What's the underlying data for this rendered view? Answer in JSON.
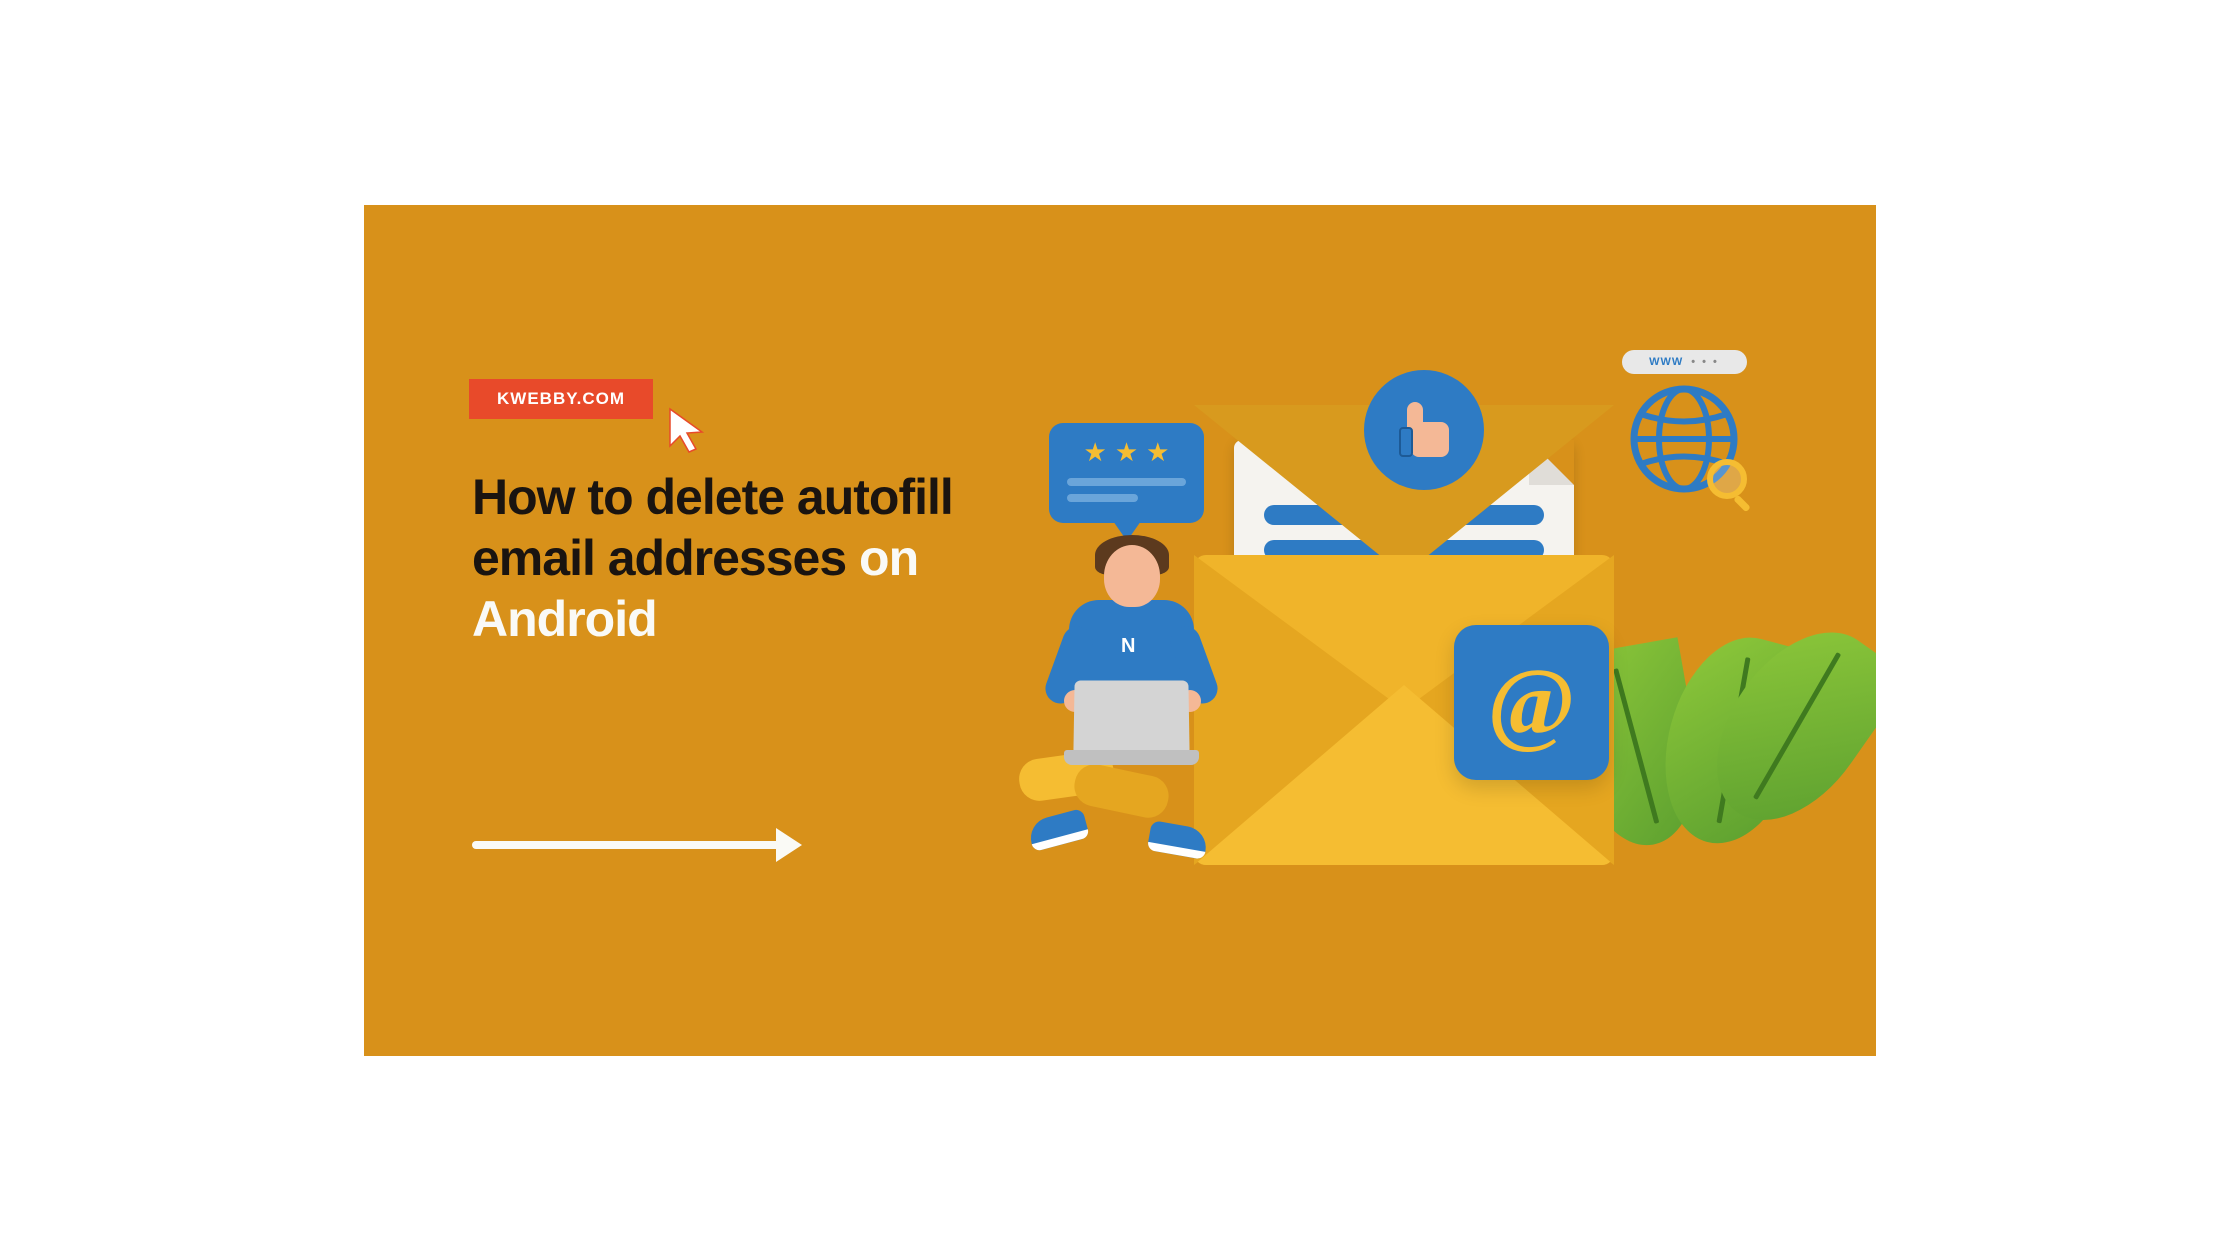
{
  "brand": {
    "label": "KWEBBY.COM"
  },
  "headline": {
    "part1": "How to delete autofill email addresses",
    "part2": " on Android"
  },
  "illustration": {
    "shirt_letter": "N",
    "www_label": "WWW",
    "www_dots": "• • •",
    "at_symbol": "@",
    "stars": [
      "★",
      "★",
      "★"
    ]
  },
  "colors": {
    "background": "#d8911a",
    "brand_badge": "#e84a2a",
    "text_dark": "#1a1410",
    "text_light": "#fafaf6",
    "blue": "#2e7bc4",
    "yellow": "#f5bd32",
    "green": "#8fc93a"
  }
}
